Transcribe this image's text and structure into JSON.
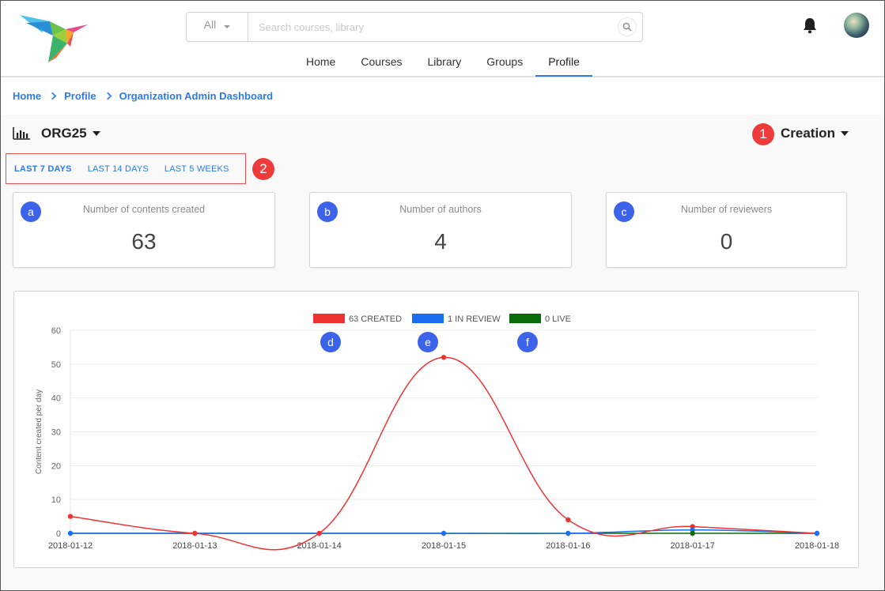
{
  "header": {
    "search": {
      "scope_value": "All",
      "placeholder": "Search courses, library"
    },
    "nav": [
      {
        "label": "Home",
        "active": false
      },
      {
        "label": "Courses",
        "active": false
      },
      {
        "label": "Library",
        "active": false
      },
      {
        "label": "Groups",
        "active": false
      },
      {
        "label": "Profile",
        "active": true
      }
    ]
  },
  "breadcrumb": [
    "Home",
    "Profile",
    "Organization Admin Dashboard"
  ],
  "org": {
    "name": "ORG25"
  },
  "dashboard_type": {
    "label": "Creation"
  },
  "callouts": [
    "1",
    "2"
  ],
  "periods": [
    {
      "label": "LAST 7 DAYS",
      "active": true
    },
    {
      "label": "LAST 14 DAYS",
      "active": false
    },
    {
      "label": "LAST 5 WEEKS",
      "active": false
    }
  ],
  "stats": [
    {
      "marker": "a",
      "title": "Number of contents created",
      "value": "63"
    },
    {
      "marker": "b",
      "title": "Number of authors",
      "value": "4"
    },
    {
      "marker": "c",
      "title": "Number of reviewers",
      "value": "0"
    }
  ],
  "chart_markers": [
    "d",
    "e",
    "f"
  ],
  "colors": {
    "accent": "#2d7be5",
    "callout": "#ee3b3b",
    "marker": "#3d63ea",
    "created": "#ee3333",
    "in_review": "#1a6ff0",
    "live": "#0a6b0a"
  },
  "chart_data": {
    "type": "line",
    "x": [
      "2018-01-12",
      "2018-01-13",
      "2018-01-14",
      "2018-01-15",
      "2018-01-16",
      "2018-01-17",
      "2018-01-18"
    ],
    "series": [
      {
        "name": "63 CREATED",
        "color": "#ee3333",
        "values": [
          5,
          0,
          0,
          52,
          4,
          2,
          0
        ]
      },
      {
        "name": "1 IN REVIEW",
        "color": "#1a6ff0",
        "values": [
          0,
          0,
          0,
          0,
          0,
          1,
          0
        ]
      },
      {
        "name": "0 LIVE",
        "color": "#0a6b0a",
        "values": [
          0,
          0,
          0,
          0,
          0,
          0,
          0
        ]
      }
    ],
    "ylabel": "Content created per day",
    "ylim": [
      0,
      60
    ],
    "yticks": [
      0,
      10,
      20,
      30,
      40,
      50,
      60
    ],
    "grid": true,
    "legend": "top-center"
  }
}
